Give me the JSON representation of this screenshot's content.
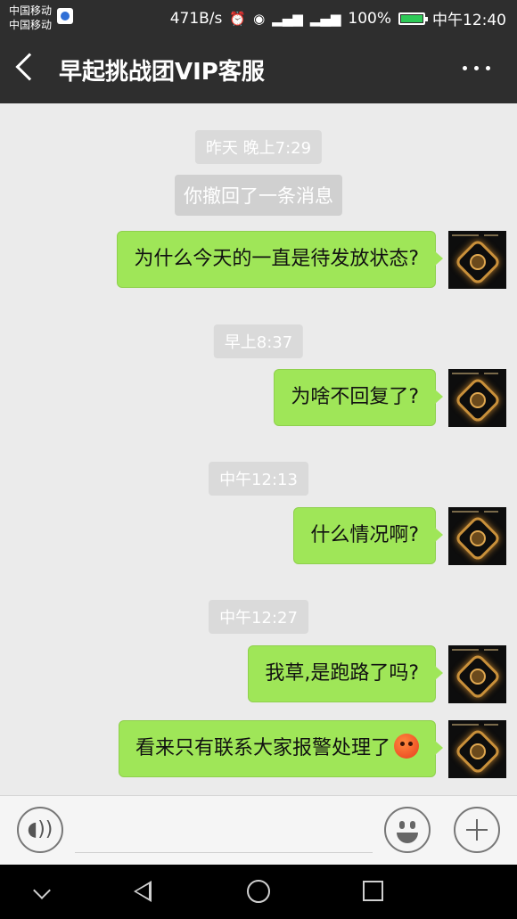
{
  "status_bar": {
    "carrier_1": "中国移动",
    "carrier_2": "中国移动",
    "net_speed": "471B/s",
    "battery": "100%",
    "time": "中午12:40",
    "icons": [
      "alarm-icon",
      "eye-icon",
      "4g-signal-icon",
      "2g-signal-icon",
      "battery-icon"
    ]
  },
  "header": {
    "title": "早起挑战团VIP客服"
  },
  "chat": {
    "items": [
      {
        "type": "time",
        "text": "昨天 晚上7:29"
      },
      {
        "type": "system",
        "text": "你撤回了一条消息"
      },
      {
        "type": "message",
        "text": "为什么今天的一直是待发放状态?"
      },
      {
        "type": "time",
        "text": "早上8:37"
      },
      {
        "type": "message",
        "text": "为啥不回复了?"
      },
      {
        "type": "time",
        "text": "中午12:13"
      },
      {
        "type": "message",
        "text": "什么情况啊?"
      },
      {
        "type": "time",
        "text": "中午12:27"
      },
      {
        "type": "message",
        "text": "我草,是跑路了吗?"
      },
      {
        "type": "message",
        "text": "看来只有联系大家报警处理了",
        "emoji": "angry-face-icon"
      }
    ]
  },
  "input_bar": {
    "text_value": ""
  },
  "colors": {
    "bubble": "#9fe658",
    "header_bg": "#2e2e2e",
    "chat_bg": "#ebebeb"
  }
}
